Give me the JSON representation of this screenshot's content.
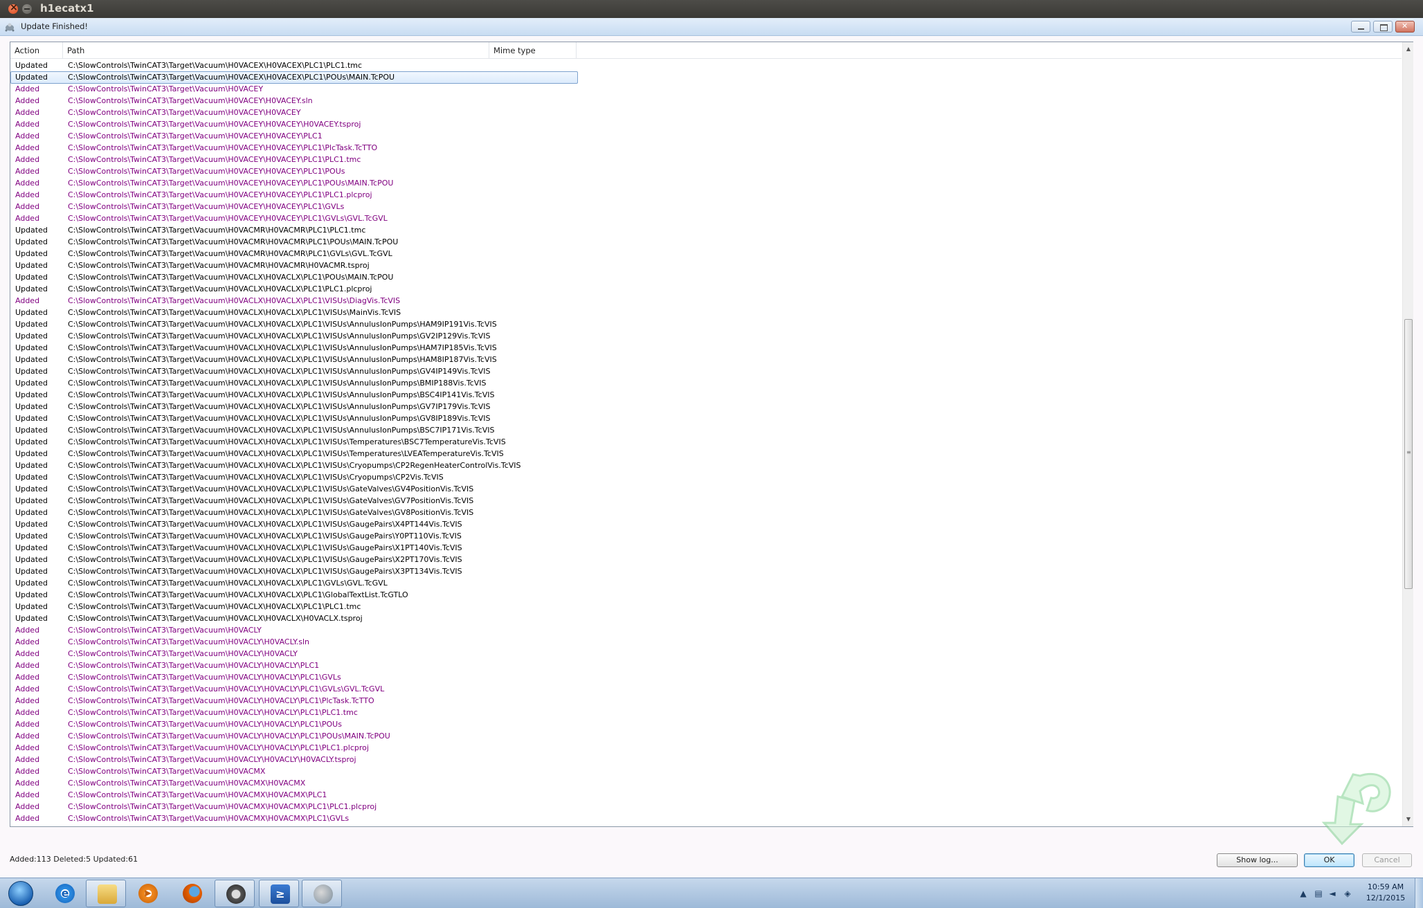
{
  "window": {
    "title": "h1ecatx1"
  },
  "dialog": {
    "title": "Update Finished!",
    "status": "Added:113 Deleted:5 Updated:61",
    "buttons": {
      "show_log": "Show log...",
      "ok": "OK",
      "cancel": "Cancel"
    }
  },
  "list": {
    "columns": [
      "Action",
      "Path",
      "Mime type"
    ],
    "colors": {
      "Updated": "#000000",
      "Added": "#800080"
    },
    "rows": [
      [
        "Updated",
        "C:\\SlowControls\\TwinCAT3\\Target\\Vacuum\\H0VACEX\\H0VACEX\\PLC1\\PLC1.tmc"
      ],
      [
        "Updated",
        "C:\\SlowControls\\TwinCAT3\\Target\\Vacuum\\H0VACEX\\H0VACEX\\PLC1\\POUs\\MAIN.TcPOU"
      ],
      [
        "Added",
        "C:\\SlowControls\\TwinCAT3\\Target\\Vacuum\\H0VACEY"
      ],
      [
        "Added",
        "C:\\SlowControls\\TwinCAT3\\Target\\Vacuum\\H0VACEY\\H0VACEY.sln"
      ],
      [
        "Added",
        "C:\\SlowControls\\TwinCAT3\\Target\\Vacuum\\H0VACEY\\H0VACEY"
      ],
      [
        "Added",
        "C:\\SlowControls\\TwinCAT3\\Target\\Vacuum\\H0VACEY\\H0VACEY\\H0VACEY.tsproj"
      ],
      [
        "Added",
        "C:\\SlowControls\\TwinCAT3\\Target\\Vacuum\\H0VACEY\\H0VACEY\\PLC1"
      ],
      [
        "Added",
        "C:\\SlowControls\\TwinCAT3\\Target\\Vacuum\\H0VACEY\\H0VACEY\\PLC1\\PlcTask.TcTTO"
      ],
      [
        "Added",
        "C:\\SlowControls\\TwinCAT3\\Target\\Vacuum\\H0VACEY\\H0VACEY\\PLC1\\PLC1.tmc"
      ],
      [
        "Added",
        "C:\\SlowControls\\TwinCAT3\\Target\\Vacuum\\H0VACEY\\H0VACEY\\PLC1\\POUs"
      ],
      [
        "Added",
        "C:\\SlowControls\\TwinCAT3\\Target\\Vacuum\\H0VACEY\\H0VACEY\\PLC1\\POUs\\MAIN.TcPOU"
      ],
      [
        "Added",
        "C:\\SlowControls\\TwinCAT3\\Target\\Vacuum\\H0VACEY\\H0VACEY\\PLC1\\PLC1.plcproj"
      ],
      [
        "Added",
        "C:\\SlowControls\\TwinCAT3\\Target\\Vacuum\\H0VACEY\\H0VACEY\\PLC1\\GVLs"
      ],
      [
        "Added",
        "C:\\SlowControls\\TwinCAT3\\Target\\Vacuum\\H0VACEY\\H0VACEY\\PLC1\\GVLs\\GVL.TcGVL"
      ],
      [
        "Updated",
        "C:\\SlowControls\\TwinCAT3\\Target\\Vacuum\\H0VACMR\\H0VACMR\\PLC1\\PLC1.tmc"
      ],
      [
        "Updated",
        "C:\\SlowControls\\TwinCAT3\\Target\\Vacuum\\H0VACMR\\H0VACMR\\PLC1\\POUs\\MAIN.TcPOU"
      ],
      [
        "Updated",
        "C:\\SlowControls\\TwinCAT3\\Target\\Vacuum\\H0VACMR\\H0VACMR\\PLC1\\GVLs\\GVL.TcGVL"
      ],
      [
        "Updated",
        "C:\\SlowControls\\TwinCAT3\\Target\\Vacuum\\H0VACMR\\H0VACMR\\H0VACMR.tsproj"
      ],
      [
        "Updated",
        "C:\\SlowControls\\TwinCAT3\\Target\\Vacuum\\H0VACLX\\H0VACLX\\PLC1\\POUs\\MAIN.TcPOU"
      ],
      [
        "Updated",
        "C:\\SlowControls\\TwinCAT3\\Target\\Vacuum\\H0VACLX\\H0VACLX\\PLC1\\PLC1.plcproj"
      ],
      [
        "Added",
        "C:\\SlowControls\\TwinCAT3\\Target\\Vacuum\\H0VACLX\\H0VACLX\\PLC1\\VISUs\\DiagVis.TcVIS"
      ],
      [
        "Updated",
        "C:\\SlowControls\\TwinCAT3\\Target\\Vacuum\\H0VACLX\\H0VACLX\\PLC1\\VISUs\\MainVis.TcVIS"
      ],
      [
        "Updated",
        "C:\\SlowControls\\TwinCAT3\\Target\\Vacuum\\H0VACLX\\H0VACLX\\PLC1\\VISUs\\AnnulusIonPumps\\HAM9IP191Vis.TcVIS"
      ],
      [
        "Updated",
        "C:\\SlowControls\\TwinCAT3\\Target\\Vacuum\\H0VACLX\\H0VACLX\\PLC1\\VISUs\\AnnulusIonPumps\\GV2IP129Vis.TcVIS"
      ],
      [
        "Updated",
        "C:\\SlowControls\\TwinCAT3\\Target\\Vacuum\\H0VACLX\\H0VACLX\\PLC1\\VISUs\\AnnulusIonPumps\\HAM7IP185Vis.TcVIS"
      ],
      [
        "Updated",
        "C:\\SlowControls\\TwinCAT3\\Target\\Vacuum\\H0VACLX\\H0VACLX\\PLC1\\VISUs\\AnnulusIonPumps\\HAM8IP187Vis.TcVIS"
      ],
      [
        "Updated",
        "C:\\SlowControls\\TwinCAT3\\Target\\Vacuum\\H0VACLX\\H0VACLX\\PLC1\\VISUs\\AnnulusIonPumps\\GV4IP149Vis.TcVIS"
      ],
      [
        "Updated",
        "C:\\SlowControls\\TwinCAT3\\Target\\Vacuum\\H0VACLX\\H0VACLX\\PLC1\\VISUs\\AnnulusIonPumps\\BMIP188Vis.TcVIS"
      ],
      [
        "Updated",
        "C:\\SlowControls\\TwinCAT3\\Target\\Vacuum\\H0VACLX\\H0VACLX\\PLC1\\VISUs\\AnnulusIonPumps\\BSC4IP141Vis.TcVIS"
      ],
      [
        "Updated",
        "C:\\SlowControls\\TwinCAT3\\Target\\Vacuum\\H0VACLX\\H0VACLX\\PLC1\\VISUs\\AnnulusIonPumps\\GV7IP179Vis.TcVIS"
      ],
      [
        "Updated",
        "C:\\SlowControls\\TwinCAT3\\Target\\Vacuum\\H0VACLX\\H0VACLX\\PLC1\\VISUs\\AnnulusIonPumps\\GV8IP189Vis.TcVIS"
      ],
      [
        "Updated",
        "C:\\SlowControls\\TwinCAT3\\Target\\Vacuum\\H0VACLX\\H0VACLX\\PLC1\\VISUs\\AnnulusIonPumps\\BSC7IP171Vis.TcVIS"
      ],
      [
        "Updated",
        "C:\\SlowControls\\TwinCAT3\\Target\\Vacuum\\H0VACLX\\H0VACLX\\PLC1\\VISUs\\Temperatures\\BSC7TemperatureVis.TcVIS"
      ],
      [
        "Updated",
        "C:\\SlowControls\\TwinCAT3\\Target\\Vacuum\\H0VACLX\\H0VACLX\\PLC1\\VISUs\\Temperatures\\LVEATemperatureVis.TcVIS"
      ],
      [
        "Updated",
        "C:\\SlowControls\\TwinCAT3\\Target\\Vacuum\\H0VACLX\\H0VACLX\\PLC1\\VISUs\\Cryopumps\\CP2RegenHeaterControlVis.TcVIS"
      ],
      [
        "Updated",
        "C:\\SlowControls\\TwinCAT3\\Target\\Vacuum\\H0VACLX\\H0VACLX\\PLC1\\VISUs\\Cryopumps\\CP2Vis.TcVIS"
      ],
      [
        "Updated",
        "C:\\SlowControls\\TwinCAT3\\Target\\Vacuum\\H0VACLX\\H0VACLX\\PLC1\\VISUs\\GateValves\\GV4PositionVis.TcVIS"
      ],
      [
        "Updated",
        "C:\\SlowControls\\TwinCAT3\\Target\\Vacuum\\H0VACLX\\H0VACLX\\PLC1\\VISUs\\GateValves\\GV7PositionVis.TcVIS"
      ],
      [
        "Updated",
        "C:\\SlowControls\\TwinCAT3\\Target\\Vacuum\\H0VACLX\\H0VACLX\\PLC1\\VISUs\\GateValves\\GV8PositionVis.TcVIS"
      ],
      [
        "Updated",
        "C:\\SlowControls\\TwinCAT3\\Target\\Vacuum\\H0VACLX\\H0VACLX\\PLC1\\VISUs\\GaugePairs\\X4PT144Vis.TcVIS"
      ],
      [
        "Updated",
        "C:\\SlowControls\\TwinCAT3\\Target\\Vacuum\\H0VACLX\\H0VACLX\\PLC1\\VISUs\\GaugePairs\\Y0PT110Vis.TcVIS"
      ],
      [
        "Updated",
        "C:\\SlowControls\\TwinCAT3\\Target\\Vacuum\\H0VACLX\\H0VACLX\\PLC1\\VISUs\\GaugePairs\\X1PT140Vis.TcVIS"
      ],
      [
        "Updated",
        "C:\\SlowControls\\TwinCAT3\\Target\\Vacuum\\H0VACLX\\H0VACLX\\PLC1\\VISUs\\GaugePairs\\X2PT170Vis.TcVIS"
      ],
      [
        "Updated",
        "C:\\SlowControls\\TwinCAT3\\Target\\Vacuum\\H0VACLX\\H0VACLX\\PLC1\\VISUs\\GaugePairs\\X3PT134Vis.TcVIS"
      ],
      [
        "Updated",
        "C:\\SlowControls\\TwinCAT3\\Target\\Vacuum\\H0VACLX\\H0VACLX\\PLC1\\GVLs\\GVL.TcGVL"
      ],
      [
        "Updated",
        "C:\\SlowControls\\TwinCAT3\\Target\\Vacuum\\H0VACLX\\H0VACLX\\PLC1\\GlobalTextList.TcGTLO"
      ],
      [
        "Updated",
        "C:\\SlowControls\\TwinCAT3\\Target\\Vacuum\\H0VACLX\\H0VACLX\\PLC1\\PLC1.tmc"
      ],
      [
        "Updated",
        "C:\\SlowControls\\TwinCAT3\\Target\\Vacuum\\H0VACLX\\H0VACLX\\H0VACLX.tsproj"
      ],
      [
        "Added",
        "C:\\SlowControls\\TwinCAT3\\Target\\Vacuum\\H0VACLY"
      ],
      [
        "Added",
        "C:\\SlowControls\\TwinCAT3\\Target\\Vacuum\\H0VACLY\\H0VACLY.sln"
      ],
      [
        "Added",
        "C:\\SlowControls\\TwinCAT3\\Target\\Vacuum\\H0VACLY\\H0VACLY"
      ],
      [
        "Added",
        "C:\\SlowControls\\TwinCAT3\\Target\\Vacuum\\H0VACLY\\H0VACLY\\PLC1"
      ],
      [
        "Added",
        "C:\\SlowControls\\TwinCAT3\\Target\\Vacuum\\H0VACLY\\H0VACLY\\PLC1\\GVLs"
      ],
      [
        "Added",
        "C:\\SlowControls\\TwinCAT3\\Target\\Vacuum\\H0VACLY\\H0VACLY\\PLC1\\GVLs\\GVL.TcGVL"
      ],
      [
        "Added",
        "C:\\SlowControls\\TwinCAT3\\Target\\Vacuum\\H0VACLY\\H0VACLY\\PLC1\\PlcTask.TcTTO"
      ],
      [
        "Added",
        "C:\\SlowControls\\TwinCAT3\\Target\\Vacuum\\H0VACLY\\H0VACLY\\PLC1\\PLC1.tmc"
      ],
      [
        "Added",
        "C:\\SlowControls\\TwinCAT3\\Target\\Vacuum\\H0VACLY\\H0VACLY\\PLC1\\POUs"
      ],
      [
        "Added",
        "C:\\SlowControls\\TwinCAT3\\Target\\Vacuum\\H0VACLY\\H0VACLY\\PLC1\\POUs\\MAIN.TcPOU"
      ],
      [
        "Added",
        "C:\\SlowControls\\TwinCAT3\\Target\\Vacuum\\H0VACLY\\H0VACLY\\PLC1\\PLC1.plcproj"
      ],
      [
        "Added",
        "C:\\SlowControls\\TwinCAT3\\Target\\Vacuum\\H0VACLY\\H0VACLY\\H0VACLY.tsproj"
      ],
      [
        "Added",
        "C:\\SlowControls\\TwinCAT3\\Target\\Vacuum\\H0VACMX"
      ],
      [
        "Added",
        "C:\\SlowControls\\TwinCAT3\\Target\\Vacuum\\H0VACMX\\H0VACMX"
      ],
      [
        "Added",
        "C:\\SlowControls\\TwinCAT3\\Target\\Vacuum\\H0VACMX\\H0VACMX\\PLC1"
      ],
      [
        "Added",
        "C:\\SlowControls\\TwinCAT3\\Target\\Vacuum\\H0VACMX\\H0VACMX\\PLC1\\PLC1.plcproj"
      ],
      [
        "Added",
        "C:\\SlowControls\\TwinCAT3\\Target\\Vacuum\\H0VACMX\\H0VACMX\\PLC1\\GVLs"
      ]
    ],
    "selected_row": 1
  },
  "taskbar": {
    "apps": [
      "start-orb",
      "internet-explorer",
      "file-explorer",
      "media-player",
      "firefox",
      "twincat",
      "powershell",
      "tortoisesvn"
    ],
    "clock": {
      "time": "10:59 AM",
      "date": "12/1/2015"
    }
  }
}
